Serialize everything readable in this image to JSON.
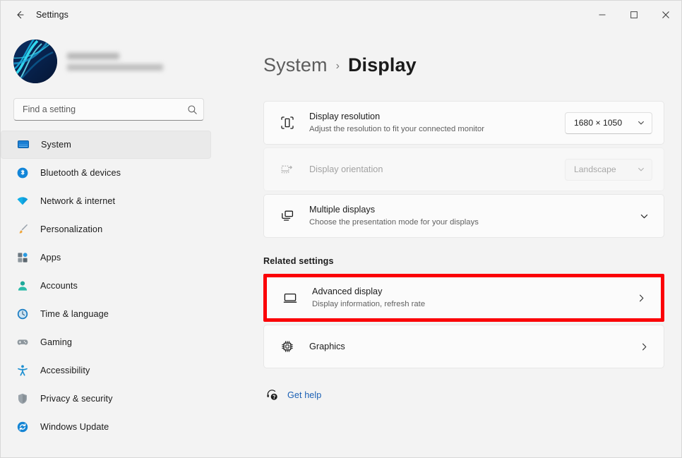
{
  "window": {
    "title": "Settings",
    "back_icon": "back-arrow-icon",
    "controls": {
      "minimize": "minimize-icon",
      "maximize": "maximize-icon",
      "close": "close-icon"
    }
  },
  "sidebar": {
    "account": {
      "avatar": "user-avatar-image",
      "name": "",
      "email": "",
      "redacted": true
    },
    "search": {
      "placeholder": "Find a setting",
      "value": "",
      "icon": "search-icon"
    },
    "items": [
      {
        "label": "System",
        "icon": "system-monitor-icon",
        "selected": true
      },
      {
        "label": "Bluetooth & devices",
        "icon": "bluetooth-icon",
        "selected": false
      },
      {
        "label": "Network & internet",
        "icon": "wifi-icon",
        "selected": false
      },
      {
        "label": "Personalization",
        "icon": "paintbrush-icon",
        "selected": false
      },
      {
        "label": "Apps",
        "icon": "apps-grid-icon",
        "selected": false
      },
      {
        "label": "Accounts",
        "icon": "person-icon",
        "selected": false
      },
      {
        "label": "Time & language",
        "icon": "clock-icon",
        "selected": false
      },
      {
        "label": "Gaming",
        "icon": "game-controller-icon",
        "selected": false
      },
      {
        "label": "Accessibility",
        "icon": "accessibility-icon",
        "selected": false
      },
      {
        "label": "Privacy & security",
        "icon": "shield-icon",
        "selected": false
      },
      {
        "label": "Windows Update",
        "icon": "update-refresh-icon",
        "selected": false
      }
    ]
  },
  "main": {
    "breadcrumb": {
      "root": "System",
      "separator": "›",
      "current": "Display"
    },
    "settings": [
      {
        "title": "Display resolution",
        "subtitle": "Adjust the resolution to fit your connected monitor",
        "icon": "display-resolution-icon",
        "control": "combobox",
        "value": "1680 × 1050",
        "disabled": false
      },
      {
        "title": "Display orientation",
        "subtitle": "",
        "icon": "display-orientation-icon",
        "control": "combobox",
        "value": "Landscape",
        "disabled": true
      },
      {
        "title": "Multiple displays",
        "subtitle": "Choose the presentation mode for your displays",
        "icon": "multiple-displays-icon",
        "control": "expander",
        "value": "",
        "disabled": false
      }
    ],
    "related": {
      "heading": "Related settings",
      "items": [
        {
          "title": "Advanced display",
          "subtitle": "Display information, refresh rate",
          "icon": "monitor-icon",
          "highlighted": true
        },
        {
          "title": "Graphics",
          "subtitle": "",
          "icon": "graphics-chip-icon",
          "highlighted": false
        }
      ]
    },
    "get_help": {
      "label": "Get help",
      "icon": "help-headset-icon"
    }
  },
  "colors": {
    "accent": "#0067c0",
    "link": "#1a5fb4",
    "highlight_box": "#fb0007",
    "page_background": "#f3f3f3",
    "card_background": "#fbfbfb"
  }
}
